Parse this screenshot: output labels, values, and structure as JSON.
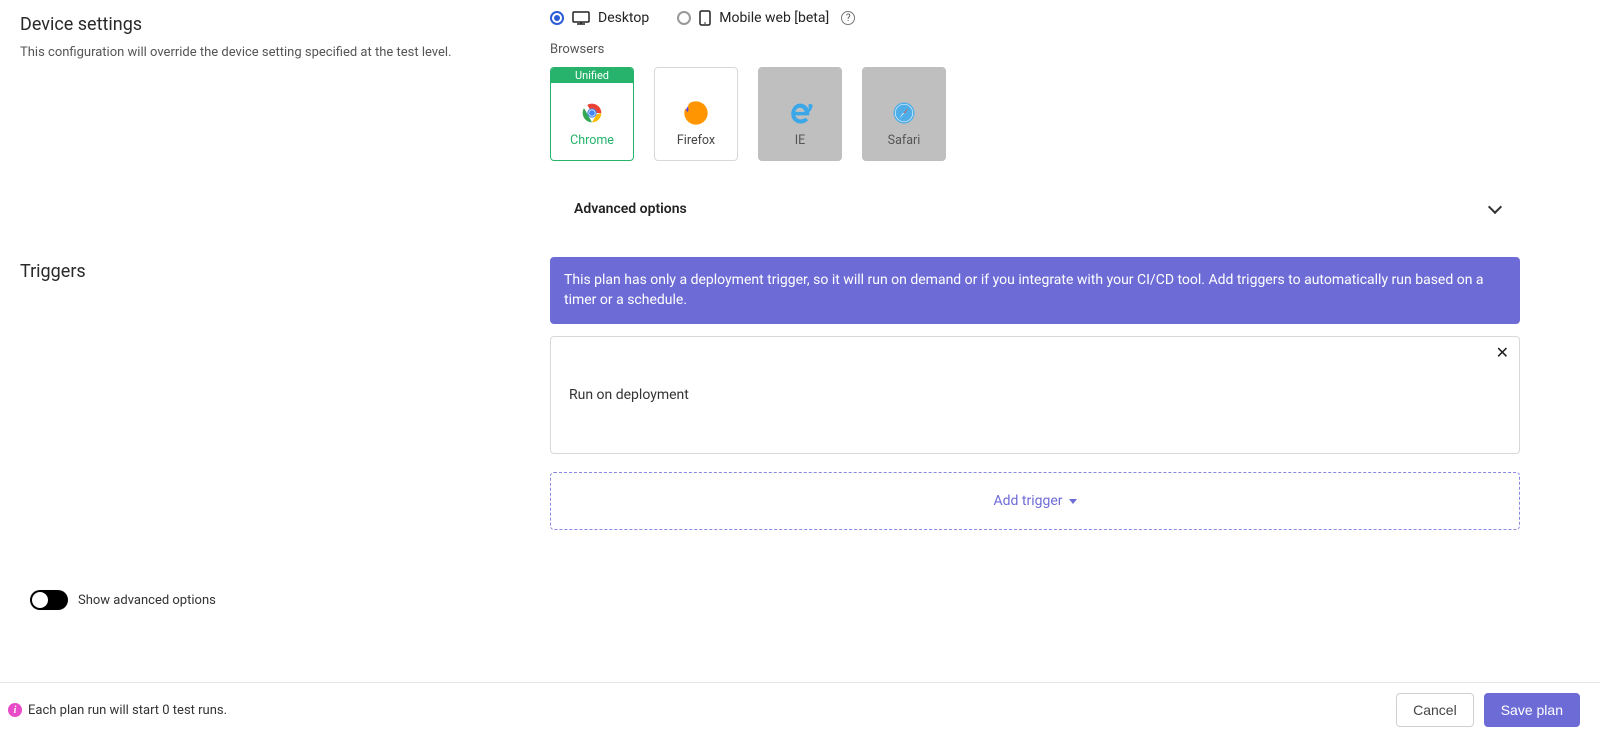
{
  "device_settings": {
    "title": "Device settings",
    "description": "This configuration will override the device setting specified at the test level.",
    "options": {
      "desktop": "Desktop",
      "mobile": "Mobile web [beta]"
    },
    "browsers_label": "Browsers",
    "unified_label": "Unified",
    "browsers": [
      {
        "name": "Chrome"
      },
      {
        "name": "Firefox"
      },
      {
        "name": "IE"
      },
      {
        "name": "Safari"
      }
    ],
    "advanced_label": "Advanced options"
  },
  "triggers": {
    "title": "Triggers",
    "banner": "This plan has only a deployment trigger, so it will run on demand or if you integrate with your CI/CD tool. Add triggers to automatically run based on a timer or a schedule.",
    "items": [
      {
        "label": "Run on deployment"
      }
    ],
    "add_label": "Add trigger"
  },
  "show_advanced_label": "Show advanced options",
  "footer": {
    "info": "Each plan run will start 0 test runs.",
    "cancel": "Cancel",
    "save": "Save plan"
  }
}
